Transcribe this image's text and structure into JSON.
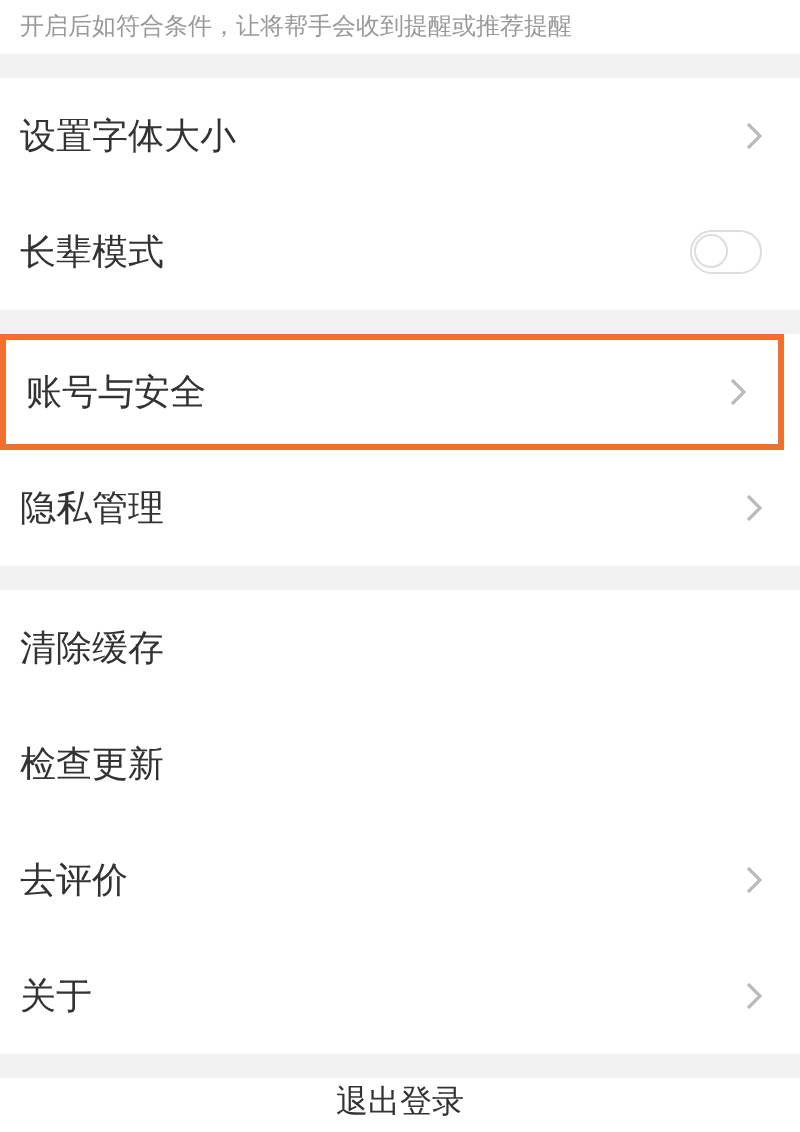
{
  "notice": "开启后如符合条件，让将帮手会收到提醒或推荐提醒",
  "groups": [
    {
      "items": [
        {
          "kind": "link",
          "label": "设置字体大小",
          "highlighted": false
        },
        {
          "kind": "toggle",
          "label": "长辈模式",
          "on": false,
          "highlighted": false
        }
      ]
    },
    {
      "items": [
        {
          "kind": "link",
          "label": "账号与安全",
          "highlighted": true
        },
        {
          "kind": "link",
          "label": "隐私管理",
          "highlighted": false
        }
      ]
    },
    {
      "items": [
        {
          "kind": "plain",
          "label": "清除缓存",
          "highlighted": false
        },
        {
          "kind": "plain",
          "label": "检查更新",
          "highlighted": false
        },
        {
          "kind": "link",
          "label": "去评价",
          "highlighted": false
        },
        {
          "kind": "link",
          "label": "关于",
          "highlighted": false
        }
      ]
    }
  ],
  "logout": "退出登录"
}
